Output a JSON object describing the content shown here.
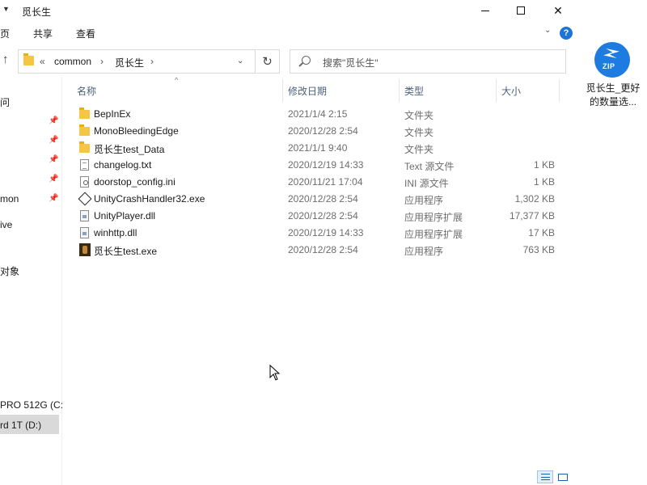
{
  "window": {
    "title": "觅长生",
    "controls": {
      "minimize": "—",
      "maximize": "□",
      "close": "✕"
    }
  },
  "ribbon": {
    "tabs": [
      "页",
      "共享",
      "查看"
    ],
    "help": "?"
  },
  "address": {
    "breadcrumbs": [
      "«",
      "common",
      "›",
      "觅长生",
      "›"
    ],
    "search_placeholder": "搜索\"觅长生\""
  },
  "navpane": {
    "items": [
      {
        "label": "问",
        "pinned": false
      },
      {
        "label": "",
        "pinned": true
      },
      {
        "label": "",
        "pinned": true
      },
      {
        "label": "",
        "pinned": true
      },
      {
        "label": "",
        "pinned": true
      },
      {
        "label": "mon",
        "pinned": true
      },
      {
        "label": "ive",
        "pinned": false
      },
      {
        "label": "对象",
        "pinned": false
      },
      {
        "label": "PRO 512G (C:",
        "pinned": false
      },
      {
        "label": "rd 1T (D:)",
        "pinned": false,
        "selected": true
      }
    ]
  },
  "columns": [
    "名称",
    "修改日期",
    "类型",
    "大小"
  ],
  "files": [
    {
      "name": "BepInEx",
      "date": "2021/1/4 2:15",
      "type": "文件夹",
      "size": "",
      "icon": "folder-icon"
    },
    {
      "name": "MonoBleedingEdge",
      "date": "2020/12/28 2:54",
      "type": "文件夹",
      "size": "",
      "icon": "folder-icon"
    },
    {
      "name": "觅长生test_Data",
      "date": "2021/1/1 9:40",
      "type": "文件夹",
      "size": "",
      "icon": "folder-icon"
    },
    {
      "name": "changelog.txt",
      "date": "2020/12/19 14:33",
      "type": "Text 源文件",
      "size": "1 KB",
      "icon": "text-file-icon"
    },
    {
      "name": "doorstop_config.ini",
      "date": "2020/11/21 17:04",
      "type": "INI 源文件",
      "size": "1 KB",
      "icon": "config-file-icon"
    },
    {
      "name": "UnityCrashHandler32.exe",
      "date": "2020/12/28 2:54",
      "type": "应用程序",
      "size": "1,302 KB",
      "icon": "unity-icon"
    },
    {
      "name": "UnityPlayer.dll",
      "date": "2020/12/28 2:54",
      "type": "应用程序扩展",
      "size": "17,377 KB",
      "icon": "dll-file-icon"
    },
    {
      "name": "winhttp.dll",
      "date": "2020/12/19 14:33",
      "type": "应用程序扩展",
      "size": "17 KB",
      "icon": "dll-file-icon"
    },
    {
      "name": "觅长生test.exe",
      "date": "2020/12/28 2:54",
      "type": "应用程序",
      "size": "763 KB",
      "icon": "game-exe-icon"
    }
  ],
  "desktop": {
    "zip_badge": "ZIP",
    "zip_caption": "觅长生_更好的数量选..."
  },
  "colors": {
    "folder": "#f6c544",
    "accent": "#1e73d8",
    "header_text": "#4c607a"
  }
}
